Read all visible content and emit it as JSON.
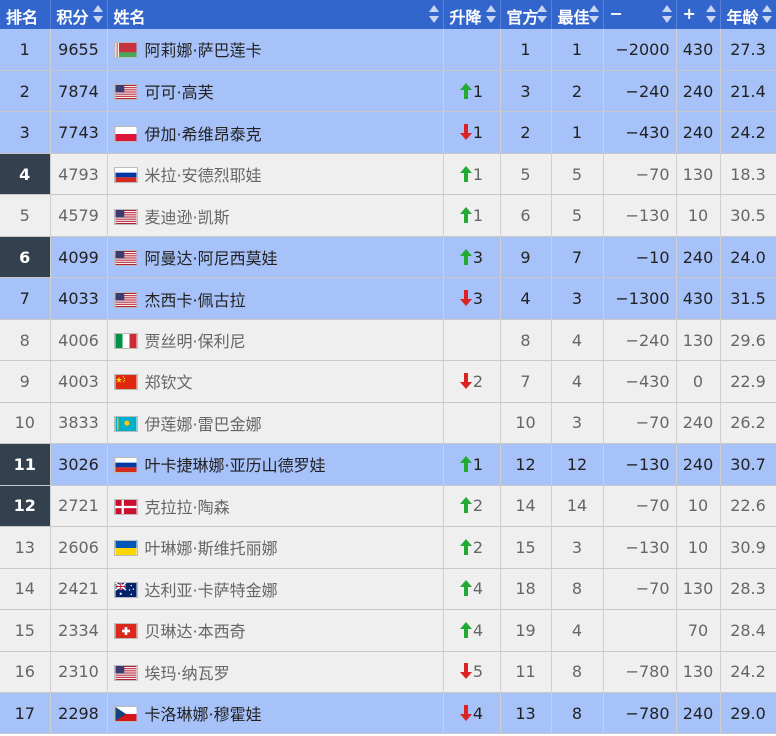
{
  "columns": [
    {
      "key": "rank",
      "label": "排名",
      "sortable": false
    },
    {
      "key": "points",
      "label": "积分",
      "sortable": true
    },
    {
      "key": "name",
      "label": "姓名",
      "sortable": true
    },
    {
      "key": "move",
      "label": "升降",
      "sortable": true
    },
    {
      "key": "official",
      "label": "官方",
      "sortable": true
    },
    {
      "key": "best",
      "label": "最佳",
      "sortable": true
    },
    {
      "key": "minus",
      "label": "−",
      "sortable": true
    },
    {
      "key": "plus",
      "label": "+",
      "sortable": true
    },
    {
      "key": "age",
      "label": "年龄",
      "sortable": true
    }
  ],
  "colors": {
    "header": "#3366cc",
    "highlight_row": "#a7c1f9",
    "plain_row": "#efefef",
    "dark_rank": "#33404e",
    "up": "#22aa33",
    "down": "#dd2222"
  },
  "rows": [
    {
      "rank": "1",
      "points": "9655",
      "flag": "belarus-flag",
      "name": "阿莉娜·萨巴莲卡",
      "move_dir": "",
      "move": "",
      "official": "1",
      "best": "1",
      "minus": "−2000",
      "plus": "430",
      "age": "27.3",
      "style": "blue",
      "dark_rank": false
    },
    {
      "rank": "2",
      "points": "7874",
      "flag": "usa-flag",
      "name": "可可·高芙",
      "move_dir": "up",
      "move": "1",
      "official": "3",
      "best": "2",
      "minus": "−240",
      "plus": "240",
      "age": "21.4",
      "style": "blue",
      "dark_rank": false
    },
    {
      "rank": "3",
      "points": "7743",
      "flag": "poland-flag",
      "name": "伊加·希维昂泰克",
      "move_dir": "down",
      "move": "1",
      "official": "2",
      "best": "1",
      "minus": "−430",
      "plus": "240",
      "age": "24.2",
      "style": "blue",
      "dark_rank": false
    },
    {
      "rank": "4",
      "points": "4793",
      "flag": "russia-flag",
      "name": "米拉·安德烈耶娃",
      "move_dir": "up",
      "move": "1",
      "official": "5",
      "best": "5",
      "minus": "−70",
      "plus": "130",
      "age": "18.3",
      "style": "grey",
      "dark_rank": true
    },
    {
      "rank": "5",
      "points": "4579",
      "flag": "usa-flag",
      "name": "麦迪逊·凯斯",
      "move_dir": "up",
      "move": "1",
      "official": "6",
      "best": "5",
      "minus": "−130",
      "plus": "10",
      "age": "30.5",
      "style": "grey",
      "dark_rank": false
    },
    {
      "rank": "6",
      "points": "4099",
      "flag": "usa-flag",
      "name": "阿曼达·阿尼西莫娃",
      "move_dir": "up",
      "move": "3",
      "official": "9",
      "best": "7",
      "minus": "−10",
      "plus": "240",
      "age": "24.0",
      "style": "blue",
      "dark_rank": true
    },
    {
      "rank": "7",
      "points": "4033",
      "flag": "usa-flag",
      "name": "杰西卡·佩古拉",
      "move_dir": "down",
      "move": "3",
      "official": "4",
      "best": "3",
      "minus": "−1300",
      "plus": "430",
      "age": "31.5",
      "style": "blue",
      "dark_rank": false
    },
    {
      "rank": "8",
      "points": "4006",
      "flag": "italy-flag",
      "name": "贾丝明·保利尼",
      "move_dir": "",
      "move": "",
      "official": "8",
      "best": "4",
      "minus": "−240",
      "plus": "130",
      "age": "29.6",
      "style": "grey",
      "dark_rank": false
    },
    {
      "rank": "9",
      "points": "4003",
      "flag": "china-flag",
      "name": "郑钦文",
      "move_dir": "down",
      "move": "2",
      "official": "7",
      "best": "4",
      "minus": "−430",
      "plus": "0",
      "age": "22.9",
      "style": "grey",
      "dark_rank": false
    },
    {
      "rank": "10",
      "points": "3833",
      "flag": "kazakhstan-flag",
      "name": "伊莲娜·雷巴金娜",
      "move_dir": "",
      "move": "",
      "official": "10",
      "best": "3",
      "minus": "−70",
      "plus": "240",
      "age": "26.2",
      "style": "grey",
      "dark_rank": false
    },
    {
      "rank": "11",
      "points": "3026",
      "flag": "russia-flag",
      "name": "叶卡捷琳娜·亚历山德罗娃",
      "move_dir": "up",
      "move": "1",
      "official": "12",
      "best": "12",
      "minus": "−130",
      "plus": "240",
      "age": "30.7",
      "style": "blue",
      "dark_rank": true
    },
    {
      "rank": "12",
      "points": "2721",
      "flag": "denmark-flag",
      "name": "克拉拉·陶森",
      "move_dir": "up",
      "move": "2",
      "official": "14",
      "best": "14",
      "minus": "−70",
      "plus": "10",
      "age": "22.6",
      "style": "grey",
      "dark_rank": true
    },
    {
      "rank": "13",
      "points": "2606",
      "flag": "ukraine-flag",
      "name": "叶琳娜·斯维托丽娜",
      "move_dir": "up",
      "move": "2",
      "official": "15",
      "best": "3",
      "minus": "−130",
      "plus": "10",
      "age": "30.9",
      "style": "grey",
      "dark_rank": false
    },
    {
      "rank": "14",
      "points": "2421",
      "flag": "australia-flag",
      "name": "达利亚·卡萨特金娜",
      "move_dir": "up",
      "move": "4",
      "official": "18",
      "best": "8",
      "minus": "−70",
      "plus": "130",
      "age": "28.3",
      "style": "grey",
      "dark_rank": false
    },
    {
      "rank": "15",
      "points": "2334",
      "flag": "switzerland-flag",
      "name": "贝琳达·本西奇",
      "move_dir": "up",
      "move": "4",
      "official": "19",
      "best": "4",
      "minus": "",
      "plus": "70",
      "age": "28.4",
      "style": "grey",
      "dark_rank": false
    },
    {
      "rank": "16",
      "points": "2310",
      "flag": "usa-flag",
      "name": "埃玛·纳瓦罗",
      "move_dir": "down",
      "move": "5",
      "official": "11",
      "best": "8",
      "minus": "−780",
      "plus": "130",
      "age": "24.2",
      "style": "grey",
      "dark_rank": false
    },
    {
      "rank": "17",
      "points": "2298",
      "flag": "czech-flag",
      "name": "卡洛琳娜·穆霍娃",
      "move_dir": "down",
      "move": "4",
      "official": "13",
      "best": "8",
      "minus": "−780",
      "plus": "240",
      "age": "29.0",
      "style": "blue",
      "dark_rank": false
    }
  ]
}
